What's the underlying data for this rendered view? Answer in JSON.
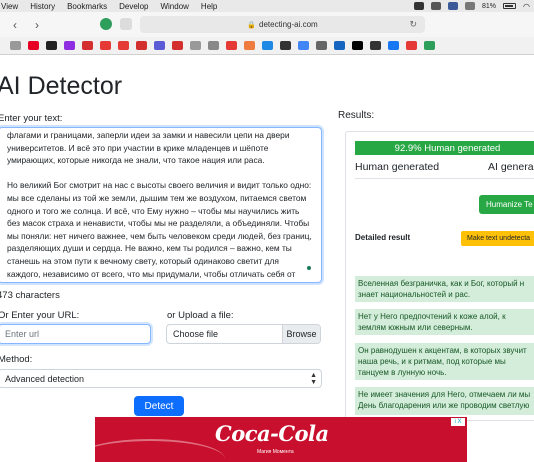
{
  "menubar": {
    "items": [
      "View",
      "History",
      "Bookmarks",
      "Develop",
      "Window",
      "Help"
    ],
    "battery": "81%"
  },
  "browser": {
    "url": "detecting-ai.com"
  },
  "page": {
    "title": "AI Detector",
    "enter_text_label": "Enter your text:",
    "text_paragraph_1": "флагами и границами, заперли идеи за замки и навесили цепи на двери университетов. И всё это при участии в крике младенцев и шёпоте умирающих, которые никогда не знали, что такое нация или раса.",
    "text_paragraph_2": "Но великий Бог смотрит на нас с высоты своего величия и видит только одно: мы все сделаны из той же земли, дышим тем же воздухом, питаемся светом одного и того же солнца. И всё, что Ему нужно – чтобы мы научились жить без масок страха и ненависти, чтобы мы не разделяли, а объединяли. Чтобы мы поняли: нет ничего важнее, чем быть человеком среди людей, без границ, разделяющих души и сердца. Не важно, кем ты родился – важно, кем ты станешь на этом пути к вечному свету, который одинаково светит для каждого, независимо от всего, что мы придумали, чтобы отличать себя от других.",
    "char_count": "473 characters",
    "url_label": "Or Enter your URL:",
    "url_placeholder": "Enter url",
    "upload_label": "or Upload a file:",
    "choose_file": "Choose file",
    "browse": "Browse",
    "method_label": "Method:",
    "method_value": "Advanced detection",
    "detect_button": "Detect"
  },
  "results": {
    "label": "Results:",
    "progress_text": "92.9% Human generated",
    "human_percent": 92.9,
    "human_label": "Human generated",
    "ai_label": "AI genera",
    "humanize_button": "Humanize Te",
    "detailed_label": "Detailed result",
    "undetectable_button": "Make text undetecta",
    "segments": [
      [
        "Вселенная безграничка, как и Бог, который н",
        "знает национальностей и рас."
      ],
      [
        "Нет у Него предпочтений к коже алой, к",
        "землям южным или северным."
      ],
      [
        "Он равнодушен к акцентам, в которых звучит",
        "наша речь, и к ритмам, под которые мы",
        "танцуем в лунную ночь."
      ],
      [
        "Не имеет значения для Него, отмечаем ли мы",
        "День благодарения или же проводим светлую"
      ]
    ]
  },
  "ad": {
    "brand": "Coca-Cola",
    "tagline": "Магия Момента",
    "badge": "i X"
  },
  "colors": {
    "primary": "#0d6efd",
    "success": "#28a745",
    "warning": "#ffc107",
    "segment_bg": "#d4edda",
    "coke_red": "#c8102e"
  }
}
